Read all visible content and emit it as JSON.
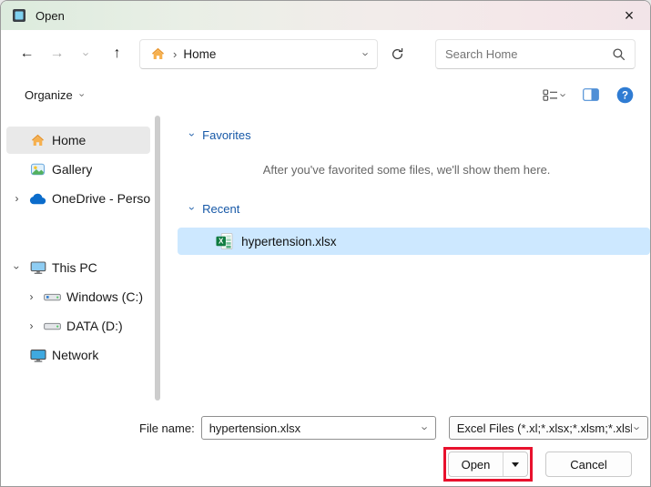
{
  "window": {
    "title": "Open",
    "close_glyph": "×"
  },
  "glyphs": {
    "chevron": "›",
    "back": "←",
    "forward": "→",
    "up": "↑"
  },
  "nav": {
    "breadcrumb": {
      "separator": "›",
      "crumb": "Home"
    },
    "search_placeholder": "Search Home"
  },
  "toolbar": {
    "organize_label": "Organize"
  },
  "sidebar": {
    "items": [
      {
        "label": "Home",
        "icon": "home-icon",
        "selected": true
      },
      {
        "label": "Gallery",
        "icon": "gallery-icon"
      },
      {
        "label": "OneDrive - Perso",
        "icon": "onedrive-icon",
        "expandable": true
      },
      {
        "label": "This PC",
        "icon": "computer-icon",
        "expandable": true,
        "expanded": true
      },
      {
        "label": "Windows (C:)",
        "icon": "drive-icon",
        "expandable": true
      },
      {
        "label": "DATA (D:)",
        "icon": "drive-icon",
        "expandable": true
      },
      {
        "label": "Network",
        "icon": "network-icon"
      }
    ]
  },
  "content": {
    "favorites": {
      "header": "Favorites",
      "empty_message": "After you've favorited some files, we'll show them here."
    },
    "recent": {
      "header": "Recent",
      "files": [
        {
          "name": "hypertension.xlsx",
          "icon": "excel-icon",
          "selected": true
        }
      ]
    }
  },
  "footer": {
    "file_name_label": "File name:",
    "file_name_value": "hypertension.xlsx",
    "file_type_value": "Excel Files (*.xl;*.xlsx;*.xlsm;*.xlsb",
    "open_label": "Open",
    "cancel_label": "Cancel"
  },
  "colors": {
    "selection": "#cde8ff",
    "section_header": "#1658a7",
    "annotation": "#e8112d"
  }
}
